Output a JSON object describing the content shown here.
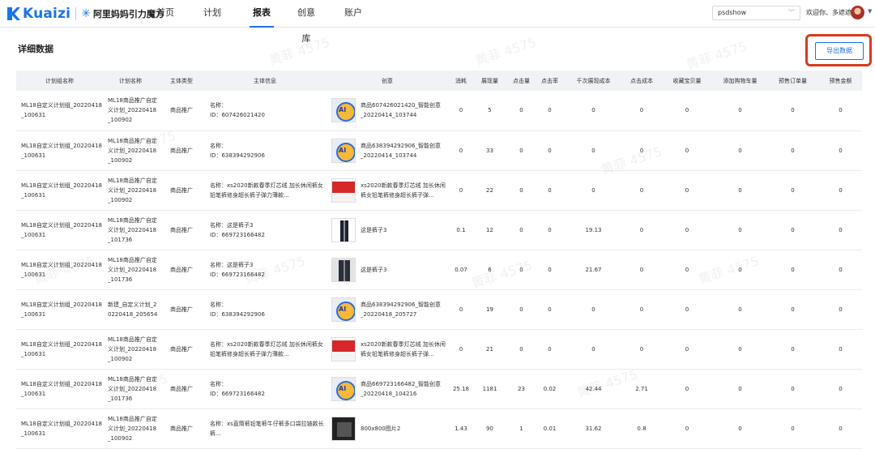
{
  "app": {
    "logo_text": "Kuaizi",
    "partner_text": "阿里妈妈引力魔方"
  },
  "nav": [
    {
      "label": "首页",
      "active": false
    },
    {
      "label": "计划",
      "active": false
    },
    {
      "label": "报表",
      "active": true
    },
    {
      "label": "创意库",
      "active": false
    },
    {
      "label": "账户",
      "active": false
    }
  ],
  "account": {
    "selected": "psdshow",
    "welcome": "欢迎你、多遮遮"
  },
  "section": {
    "title": "详细数据",
    "export_label": "导出数据"
  },
  "watermark": "黄菲 4575",
  "table": {
    "headers": [
      "计划组名称",
      "计划名称",
      "主体类型",
      "主体信息",
      "创意",
      "消耗",
      "展现量",
      "点击量",
      "点击率",
      "千次展现成本",
      "点击成本",
      "收藏宝贝量",
      "添加购物车量",
      "预售订单量",
      "预售金额"
    ],
    "rows": [
      {
        "group": "ML18自定义计划组_20220418_100631",
        "plan": "ML18商品推广自定义计划_20220418_100902",
        "type": "商品推广",
        "subject": "名称：\nID：607426021420",
        "thumb": "ai",
        "creative": "商品607426021420_智能创意_20220414_103744",
        "cost": "0",
        "impr": "5",
        "clicks": "0",
        "ctr": "0",
        "cpm": "0",
        "cpc": "0",
        "fav": "0",
        "cart": "0",
        "pre_orders": "0",
        "pre_amount": "0"
      },
      {
        "group": "ML18自定义计划组_20220418_100631",
        "plan": "ML18商品推广自定义计划_20220418_100902",
        "type": "商品推广",
        "subject": "名称：\nID：638394292906",
        "thumb": "ai",
        "creative": "商品638394292906_智能创意_20220414_103744",
        "cost": "0",
        "impr": "33",
        "clicks": "0",
        "ctr": "0",
        "cpm": "0",
        "cpc": "0",
        "fav": "0",
        "cart": "0",
        "pre_orders": "0",
        "pre_amount": "0"
      },
      {
        "group": "ML18自定义计划组_20220418_100631",
        "plan": "ML18商品推广自定义计划_20220418_100902",
        "type": "商品推广",
        "subject": "名称：xs2020新款春季灯芯绒 加长休闲裤女铅笔裤修身超长裤子弹力薄款...",
        "thumb": "red",
        "creative": "xs2020新款春季灯芯绒 加长休闲裤女铅笔裤修身超长裤子弹...",
        "cost": "0",
        "impr": "22",
        "clicks": "0",
        "ctr": "0",
        "cpm": "0",
        "cpc": "0",
        "fav": "0",
        "cart": "0",
        "pre_orders": "0",
        "pre_amount": "0"
      },
      {
        "group": "ML18自定义计划组_20220418_100631",
        "plan": "ML18商品推广自定义计划_20220418_101736",
        "type": "商品推广",
        "subject": "名称：这是裤子3\nID：669723166482",
        "thumb": "pants",
        "creative": "这是裤子3",
        "cost": "0.1",
        "impr": "12",
        "clicks": "0",
        "ctr": "0",
        "cpm": "19.13",
        "cpc": "0",
        "fav": "0",
        "cart": "0",
        "pre_orders": "0",
        "pre_amount": "0"
      },
      {
        "group": "ML18自定义计划组_20220418_100631",
        "plan": "ML18商品推广自定义计划_20220418_101736",
        "type": "商品推广",
        "subject": "名称：这是裤子3\nID：669723166482",
        "thumb": "pants2",
        "creative": "这是裤子3",
        "cost": "0.07",
        "impr": "6",
        "clicks": "0",
        "ctr": "0",
        "cpm": "21.67",
        "cpc": "0",
        "fav": "0",
        "cart": "0",
        "pre_orders": "0",
        "pre_amount": "0"
      },
      {
        "group": "ML18自定义计划组_20220418_100631",
        "plan": "新建_自定义计划_20220418_205654",
        "type": "商品推广",
        "subject": "名称：\nID：638394292906",
        "thumb": "ai",
        "creative": "商品638394292906_智能创意_20220418_205727",
        "cost": "0",
        "impr": "19",
        "clicks": "0",
        "ctr": "0",
        "cpm": "0",
        "cpc": "0",
        "fav": "0",
        "cart": "0",
        "pre_orders": "0",
        "pre_amount": "0"
      },
      {
        "group": "ML18自定义计划组_20220418_100631",
        "plan": "ML18商品推广自定义计划_20220418_100902",
        "type": "商品推广",
        "subject": "名称：xs2020新款春季灯芯绒 加长休闲裤女铅笔裤修身超长裤子弹力薄款...",
        "thumb": "red",
        "creative": "xs2020新款春季灯芯绒 加长休闲裤女铅笔裤修身超长裤子弹...",
        "cost": "0",
        "impr": "21",
        "clicks": "0",
        "ctr": "0",
        "cpm": "0",
        "cpc": "0",
        "fav": "0",
        "cart": "0",
        "pre_orders": "0",
        "pre_amount": "0"
      },
      {
        "group": "ML18自定义计划组_20220418_100631",
        "plan": "ML18商品推广自定义计划_20220418_101736",
        "type": "商品推广",
        "subject": "名称：\nID：669723166482",
        "thumb": "ai",
        "creative": "商品669723166482_智能创意_20220418_104216",
        "cost": "25.18",
        "impr": "1181",
        "clicks": "23",
        "ctr": "0.02",
        "cpm": "42.44",
        "cpc": "2.71",
        "fav": "0",
        "cart": "0",
        "pre_orders": "0",
        "pre_amount": "0"
      },
      {
        "group": "ML18自定义计划组_20220418_100631",
        "plan": "ML18商品推广自定义计划_20220418_100902",
        "type": "商品推广",
        "subject": "名称：xs直筒裤铅笔裤牛仔裤多口袋拉链款长裤...",
        "thumb": "dark",
        "creative": "800x800图片2",
        "cost": "1.43",
        "impr": "90",
        "clicks": "1",
        "ctr": "0.01",
        "cpm": "31.62",
        "cpc": "0.8",
        "fav": "0",
        "cart": "0",
        "pre_orders": "0",
        "pre_amount": "0"
      }
    ]
  }
}
